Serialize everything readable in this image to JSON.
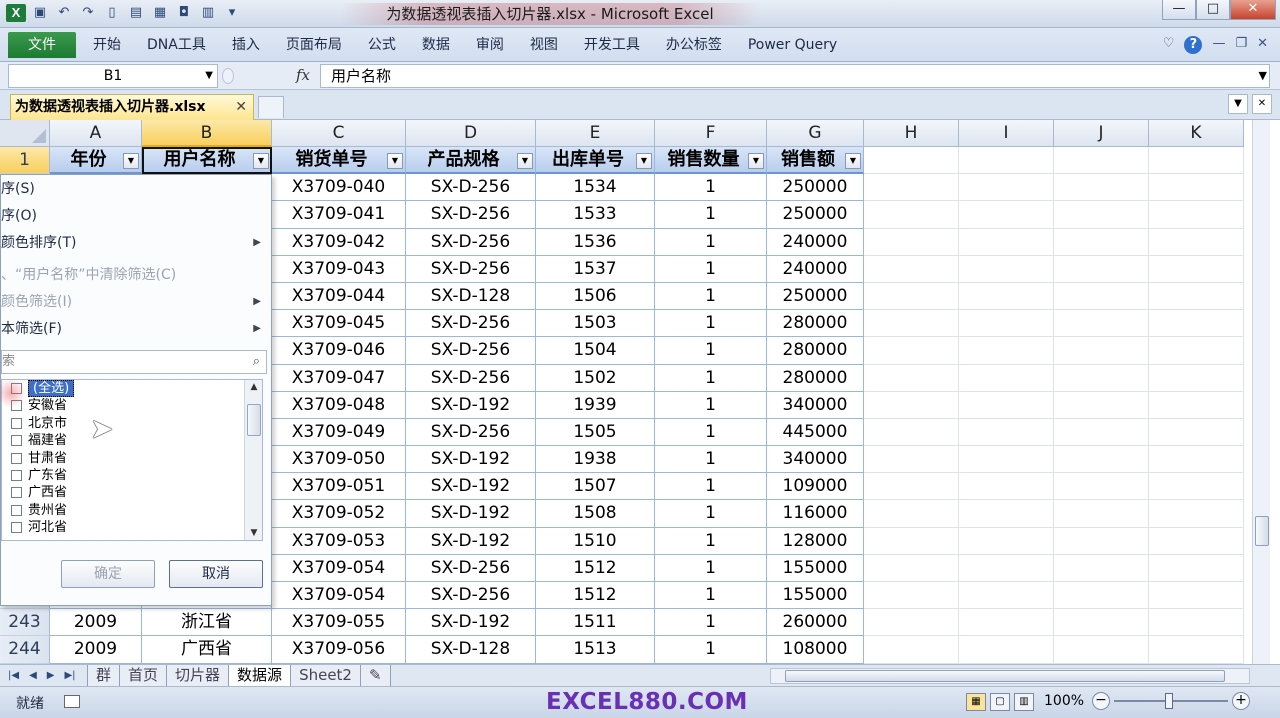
{
  "window": {
    "title": "为数据透视表插入切片器.xlsx - Microsoft Excel",
    "min": "—",
    "max": "□",
    "close": "✕"
  },
  "ribbon": {
    "file": "文件",
    "tabs": [
      "开始",
      "DNA工具",
      "插入",
      "页面布局",
      "公式",
      "数据",
      "审阅",
      "视图",
      "开发工具",
      "办公标签",
      "Power Query"
    ]
  },
  "formula_bar": {
    "name_box": "B1",
    "fx": "fx",
    "value": "用户名称"
  },
  "workbook": {
    "tab_label": "为数据透视表插入切片器.xlsx",
    "tab_close": "✕"
  },
  "columns": [
    "A",
    "B",
    "C",
    "D",
    "E",
    "F",
    "G",
    "H",
    "I",
    "J",
    "K"
  ],
  "headers": [
    "年份",
    "用户名称",
    "销货单号",
    "产品规格",
    "出库单号",
    "销售数量",
    "销售额"
  ],
  "header_row_num": "1",
  "rows": [
    {
      "r": "",
      "A": "",
      "B": "",
      "C": "X3709-040",
      "D": "SX-D-256",
      "E": "1534",
      "F": "1",
      "G": "250000"
    },
    {
      "r": "",
      "A": "",
      "B": "",
      "C": "X3709-041",
      "D": "SX-D-256",
      "E": "1533",
      "F": "1",
      "G": "250000"
    },
    {
      "r": "",
      "A": "",
      "B": "",
      "C": "X3709-042",
      "D": "SX-D-256",
      "E": "1536",
      "F": "1",
      "G": "240000"
    },
    {
      "r": "",
      "A": "",
      "B": "",
      "C": "X3709-043",
      "D": "SX-D-256",
      "E": "1537",
      "F": "1",
      "G": "240000"
    },
    {
      "r": "",
      "A": "",
      "B": "",
      "C": "X3709-044",
      "D": "SX-D-128",
      "E": "1506",
      "F": "1",
      "G": "250000"
    },
    {
      "r": "",
      "A": "",
      "B": "",
      "C": "X3709-045",
      "D": "SX-D-256",
      "E": "1503",
      "F": "1",
      "G": "280000"
    },
    {
      "r": "",
      "A": "",
      "B": "",
      "C": "X3709-046",
      "D": "SX-D-256",
      "E": "1504",
      "F": "1",
      "G": "280000"
    },
    {
      "r": "",
      "A": "",
      "B": "",
      "C": "X3709-047",
      "D": "SX-D-256",
      "E": "1502",
      "F": "1",
      "G": "280000"
    },
    {
      "r": "",
      "A": "",
      "B": "",
      "C": "X3709-048",
      "D": "SX-D-192",
      "E": "1939",
      "F": "1",
      "G": "340000"
    },
    {
      "r": "",
      "A": "",
      "B": "",
      "C": "X3709-049",
      "D": "SX-D-256",
      "E": "1505",
      "F": "1",
      "G": "445000"
    },
    {
      "r": "",
      "A": "",
      "B": "",
      "C": "X3709-050",
      "D": "SX-D-192",
      "E": "1938",
      "F": "1",
      "G": "340000"
    },
    {
      "r": "",
      "A": "",
      "B": "",
      "C": "X3709-051",
      "D": "SX-D-192",
      "E": "1507",
      "F": "1",
      "G": "109000"
    },
    {
      "r": "",
      "A": "",
      "B": "",
      "C": "X3709-052",
      "D": "SX-D-192",
      "E": "1508",
      "F": "1",
      "G": "116000"
    },
    {
      "r": "",
      "A": "",
      "B": "",
      "C": "X3709-053",
      "D": "SX-D-192",
      "E": "1510",
      "F": "1",
      "G": "128000"
    },
    {
      "r": "",
      "A": "",
      "B": "",
      "C": "X3709-054",
      "D": "SX-D-256",
      "E": "1512",
      "F": "1",
      "G": "155000"
    },
    {
      "r": "",
      "A": "",
      "B": "",
      "C": "X3709-054",
      "D": "SX-D-256",
      "E": "1512",
      "F": "1",
      "G": "155000"
    },
    {
      "r": "243",
      "A": "2009",
      "B": "浙江省",
      "C": "X3709-055",
      "D": "SX-D-192",
      "E": "1511",
      "F": "1",
      "G": "260000"
    },
    {
      "r": "244",
      "A": "2009",
      "B": "广西省",
      "C": "X3709-056",
      "D": "SX-D-128",
      "E": "1513",
      "F": "1",
      "G": "108000"
    }
  ],
  "filter_menu": {
    "items": [
      {
        "label": "序(S)",
        "disabled": false,
        "arrow": false
      },
      {
        "label": "序(O)",
        "disabled": false,
        "arrow": false
      },
      {
        "label": "颜色排序(T)",
        "disabled": false,
        "arrow": true
      },
      {
        "label": "、“用户名称”中清除筛选(C)",
        "disabled": true,
        "arrow": false
      },
      {
        "label": "颜色筛选(I)",
        "disabled": true,
        "arrow": true
      },
      {
        "label": "本筛选(F)",
        "disabled": false,
        "arrow": true
      }
    ],
    "search_placeholder": "索",
    "list": [
      "(全选)",
      "安徽省",
      "北京市",
      "福建省",
      "甘肃省",
      "广东省",
      "广西省",
      "贵州省",
      "河北省"
    ],
    "ok": "确定",
    "cancel": "取消"
  },
  "sheets": [
    "群",
    "首页",
    "切片器",
    "数据源",
    "Sheet2"
  ],
  "active_sheet": "数据源",
  "status": {
    "ready": "就绪",
    "watermark": "EXCEL880.COM",
    "zoom": "100%"
  }
}
